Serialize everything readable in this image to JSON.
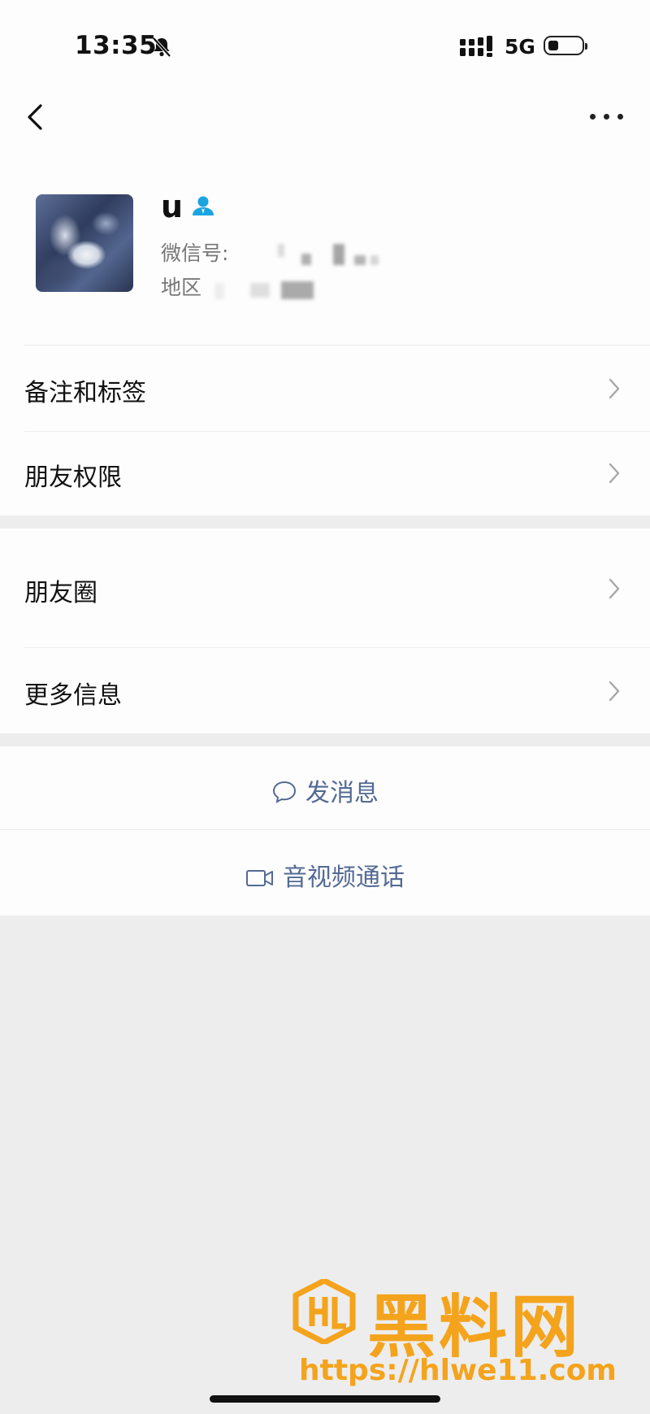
{
  "status_bar": {
    "time": "13:35",
    "network": "5G",
    "mute_icon": "bell-slash-icon",
    "signal_icon": "signal-bars-icon",
    "battery_icon": "battery-icon"
  },
  "nav": {
    "back_icon": "chevron-left-icon",
    "more_icon": "ellipsis-icon"
  },
  "profile": {
    "name": "u",
    "badge_icon": "person-icon",
    "wechat_id_label": "微信号:",
    "region_label": "地区",
    "badge_color": "#1aa4e0"
  },
  "menu_group_1": [
    {
      "label": "备注和标签",
      "icon": "chevron-right-icon"
    },
    {
      "label": "朋友权限",
      "icon": "chevron-right-icon"
    }
  ],
  "menu_group_2": [
    {
      "label": "朋友圈",
      "icon": "chevron-right-icon"
    },
    {
      "label": "更多信息",
      "icon": "chevron-right-icon"
    }
  ],
  "actions": {
    "send_message": {
      "label": "发消息",
      "icon": "chat-bubble-icon"
    },
    "av_call": {
      "label": "音视频通话",
      "icon": "video-camera-icon"
    },
    "link_color": "#536a94"
  },
  "watermark": {
    "text": "黑料网",
    "url": "https://hlwe11.com",
    "color": "#f4a31c"
  }
}
